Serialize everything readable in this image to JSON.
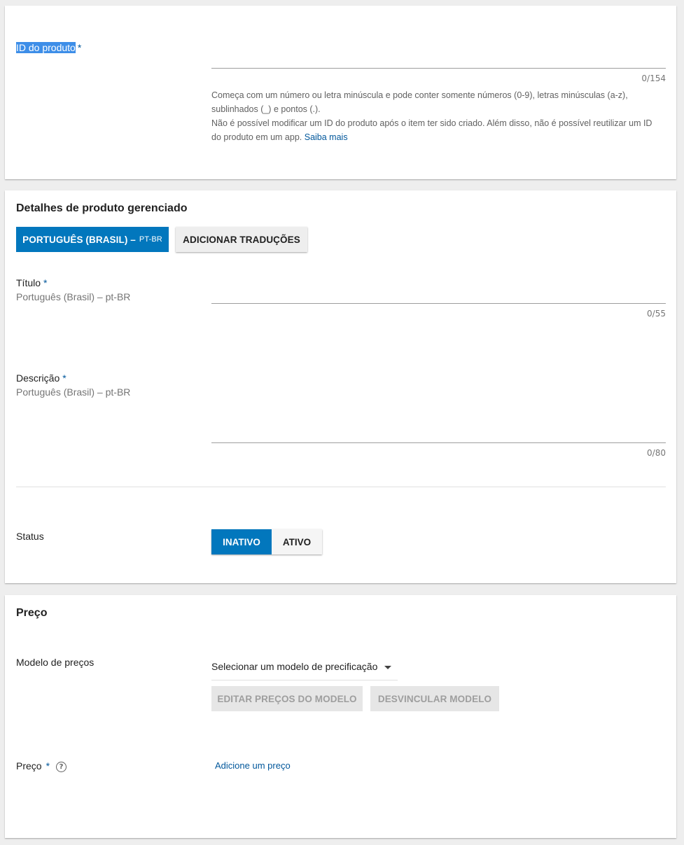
{
  "product_id": {
    "label": "ID do produto",
    "required_mark": "*",
    "counter": "0/154",
    "helper_line1": "Começa com um número ou letra minúscula e pode conter somente números (0-9), letras minúsculas (a-z),",
    "helper_line2": "sublinhados (_) e pontos (.).",
    "helper_line3": "Não é possível modificar um ID do produto após o item ter sido criado. Além disso, não é possível reutilizar um ID",
    "helper_line4": "do produto em um app.",
    "learn_more": "Saiba mais"
  },
  "details": {
    "title": "Detalhes de produto gerenciado",
    "language_button": "PORTUGUÊS (BRASIL) –",
    "language_code": "PT-BR",
    "add_translations": "ADICIONAR TRADUÇÕES",
    "title_field": {
      "label": "Título",
      "required_mark": "*",
      "sublabel": "Português (Brasil) – pt-BR",
      "counter": "0/55"
    },
    "description_field": {
      "label": "Descrição",
      "required_mark": "*",
      "sublabel": "Português (Brasil) – pt-BR",
      "counter": "0/80"
    },
    "status": {
      "label": "Status",
      "inactive": "INATIVO",
      "active": "ATIVO",
      "selected": "INATIVO"
    }
  },
  "price": {
    "title": "Preço",
    "model_label": "Modelo de preços",
    "model_select": "Selecionar um modelo de precificação",
    "edit_model_prices": "EDITAR PREÇOS DO MODELO",
    "unlink_model": "DESVINCULAR MODELO",
    "price_label": "Preço",
    "required_mark": "*",
    "help_icon": "help-icon",
    "add_price": "Adicione um preço"
  },
  "colors": {
    "primary": "#0277bd",
    "link": "#01579b",
    "selection": "#3d8ee8"
  }
}
